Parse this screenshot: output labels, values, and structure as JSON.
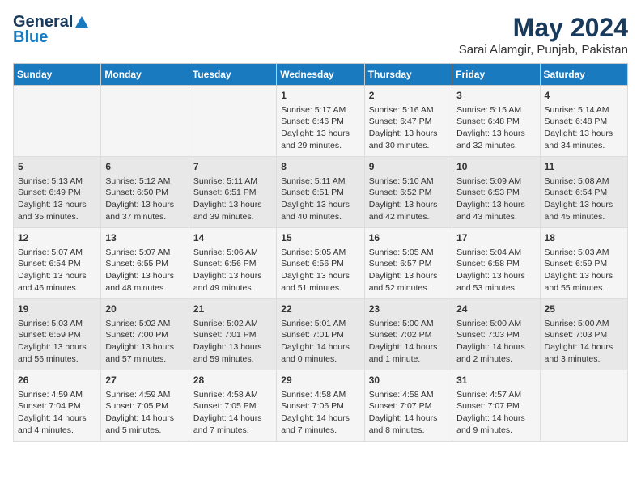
{
  "logo": {
    "line1": "General",
    "line2": "Blue"
  },
  "title": "May 2024",
  "subtitle": "Sarai Alamgir, Punjab, Pakistan",
  "days_of_week": [
    "Sunday",
    "Monday",
    "Tuesday",
    "Wednesday",
    "Thursday",
    "Friday",
    "Saturday"
  ],
  "weeks": [
    [
      {
        "day": "",
        "content": ""
      },
      {
        "day": "",
        "content": ""
      },
      {
        "day": "",
        "content": ""
      },
      {
        "day": "1",
        "content": "Sunrise: 5:17 AM\nSunset: 6:46 PM\nDaylight: 13 hours\nand 29 minutes."
      },
      {
        "day": "2",
        "content": "Sunrise: 5:16 AM\nSunset: 6:47 PM\nDaylight: 13 hours\nand 30 minutes."
      },
      {
        "day": "3",
        "content": "Sunrise: 5:15 AM\nSunset: 6:48 PM\nDaylight: 13 hours\nand 32 minutes."
      },
      {
        "day": "4",
        "content": "Sunrise: 5:14 AM\nSunset: 6:48 PM\nDaylight: 13 hours\nand 34 minutes."
      }
    ],
    [
      {
        "day": "5",
        "content": "Sunrise: 5:13 AM\nSunset: 6:49 PM\nDaylight: 13 hours\nand 35 minutes."
      },
      {
        "day": "6",
        "content": "Sunrise: 5:12 AM\nSunset: 6:50 PM\nDaylight: 13 hours\nand 37 minutes."
      },
      {
        "day": "7",
        "content": "Sunrise: 5:11 AM\nSunset: 6:51 PM\nDaylight: 13 hours\nand 39 minutes."
      },
      {
        "day": "8",
        "content": "Sunrise: 5:11 AM\nSunset: 6:51 PM\nDaylight: 13 hours\nand 40 minutes."
      },
      {
        "day": "9",
        "content": "Sunrise: 5:10 AM\nSunset: 6:52 PM\nDaylight: 13 hours\nand 42 minutes."
      },
      {
        "day": "10",
        "content": "Sunrise: 5:09 AM\nSunset: 6:53 PM\nDaylight: 13 hours\nand 43 minutes."
      },
      {
        "day": "11",
        "content": "Sunrise: 5:08 AM\nSunset: 6:54 PM\nDaylight: 13 hours\nand 45 minutes."
      }
    ],
    [
      {
        "day": "12",
        "content": "Sunrise: 5:07 AM\nSunset: 6:54 PM\nDaylight: 13 hours\nand 46 minutes."
      },
      {
        "day": "13",
        "content": "Sunrise: 5:07 AM\nSunset: 6:55 PM\nDaylight: 13 hours\nand 48 minutes."
      },
      {
        "day": "14",
        "content": "Sunrise: 5:06 AM\nSunset: 6:56 PM\nDaylight: 13 hours\nand 49 minutes."
      },
      {
        "day": "15",
        "content": "Sunrise: 5:05 AM\nSunset: 6:56 PM\nDaylight: 13 hours\nand 51 minutes."
      },
      {
        "day": "16",
        "content": "Sunrise: 5:05 AM\nSunset: 6:57 PM\nDaylight: 13 hours\nand 52 minutes."
      },
      {
        "day": "17",
        "content": "Sunrise: 5:04 AM\nSunset: 6:58 PM\nDaylight: 13 hours\nand 53 minutes."
      },
      {
        "day": "18",
        "content": "Sunrise: 5:03 AM\nSunset: 6:59 PM\nDaylight: 13 hours\nand 55 minutes."
      }
    ],
    [
      {
        "day": "19",
        "content": "Sunrise: 5:03 AM\nSunset: 6:59 PM\nDaylight: 13 hours\nand 56 minutes."
      },
      {
        "day": "20",
        "content": "Sunrise: 5:02 AM\nSunset: 7:00 PM\nDaylight: 13 hours\nand 57 minutes."
      },
      {
        "day": "21",
        "content": "Sunrise: 5:02 AM\nSunset: 7:01 PM\nDaylight: 13 hours\nand 59 minutes."
      },
      {
        "day": "22",
        "content": "Sunrise: 5:01 AM\nSunset: 7:01 PM\nDaylight: 14 hours\nand 0 minutes."
      },
      {
        "day": "23",
        "content": "Sunrise: 5:00 AM\nSunset: 7:02 PM\nDaylight: 14 hours\nand 1 minute."
      },
      {
        "day": "24",
        "content": "Sunrise: 5:00 AM\nSunset: 7:03 PM\nDaylight: 14 hours\nand 2 minutes."
      },
      {
        "day": "25",
        "content": "Sunrise: 5:00 AM\nSunset: 7:03 PM\nDaylight: 14 hours\nand 3 minutes."
      }
    ],
    [
      {
        "day": "26",
        "content": "Sunrise: 4:59 AM\nSunset: 7:04 PM\nDaylight: 14 hours\nand 4 minutes."
      },
      {
        "day": "27",
        "content": "Sunrise: 4:59 AM\nSunset: 7:05 PM\nDaylight: 14 hours\nand 5 minutes."
      },
      {
        "day": "28",
        "content": "Sunrise: 4:58 AM\nSunset: 7:05 PM\nDaylight: 14 hours\nand 7 minutes."
      },
      {
        "day": "29",
        "content": "Sunrise: 4:58 AM\nSunset: 7:06 PM\nDaylight: 14 hours\nand 7 minutes."
      },
      {
        "day": "30",
        "content": "Sunrise: 4:58 AM\nSunset: 7:07 PM\nDaylight: 14 hours\nand 8 minutes."
      },
      {
        "day": "31",
        "content": "Sunrise: 4:57 AM\nSunset: 7:07 PM\nDaylight: 14 hours\nand 9 minutes."
      },
      {
        "day": "",
        "content": ""
      }
    ]
  ]
}
